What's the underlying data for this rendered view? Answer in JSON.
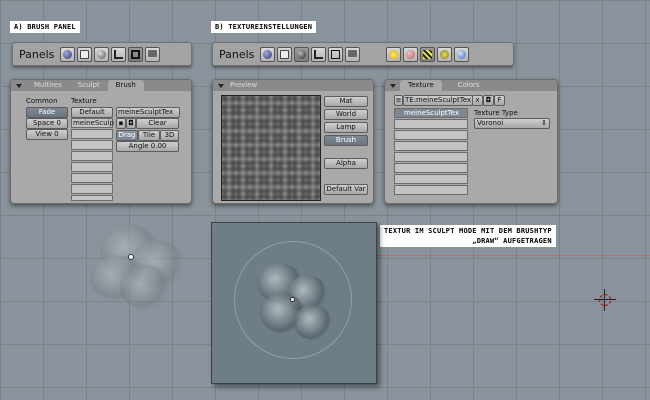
{
  "captions": {
    "brush_panel": "A) BRUSH PANEL",
    "textureinstellungen": "B) TEXTUREINSTELLUNGEN",
    "sculpt_note_line1": "TEXTUR IM SCULPT MODE MIT DEM BRUSHTYP",
    "sculpt_note_line2": "„DRAW“ AUFGETRAGEN"
  },
  "toolbar_a": {
    "label": "Panels",
    "icons": [
      "view-icon",
      "render-icon",
      "material-icon",
      "edit-icon",
      "object-icon",
      "scene-icon"
    ]
  },
  "toolbar_b": {
    "label": "Panels",
    "icons": [
      "view-icon",
      "render-icon",
      "material-icon",
      "edit-icon",
      "object-icon",
      "scene-icon"
    ],
    "shading_icons": [
      "lamp-icon",
      "material-sphere-icon",
      "texture-icon",
      "radiosity-icon",
      "world-icon"
    ]
  },
  "brush_panel": {
    "tabs": [
      "Multires",
      "Sculpt",
      "Brush"
    ],
    "active_tab": "Brush",
    "common_label": "Common",
    "fade_button": "Fade",
    "space_field": "Space 0",
    "view_field": "View 0",
    "texture_label": "Texture",
    "default_button": "Default",
    "slots": [
      "meineSculp",
      "",
      "",
      "",
      "",
      "",
      "",
      ""
    ],
    "texture_name": "meineSculptTex",
    "clear_button": "Clear",
    "drag_label": "Drag",
    "tile_button": "Tile",
    "threed_button": "3D",
    "angle_field": "Angle 0.00"
  },
  "preview_panel": {
    "title": "Preview",
    "buttons": [
      "Mat",
      "World",
      "Lamp",
      "Brush"
    ],
    "active_button": "Brush",
    "alpha_button": "Alpha",
    "default_var_button": "Default Var"
  },
  "texture_panel": {
    "tabs": [
      "Texture",
      "Colors"
    ],
    "active_tab": "Texture",
    "name_field": "TE:meineSculptTex",
    "name_buttons": [
      "x",
      "fake-user-icon",
      "F"
    ],
    "list": [
      "meineSculptTex",
      "",
      "",
      "",
      "",
      "",
      "",
      ""
    ],
    "texture_type_label": "Texture Type",
    "texture_type_value": "Voronoi"
  }
}
